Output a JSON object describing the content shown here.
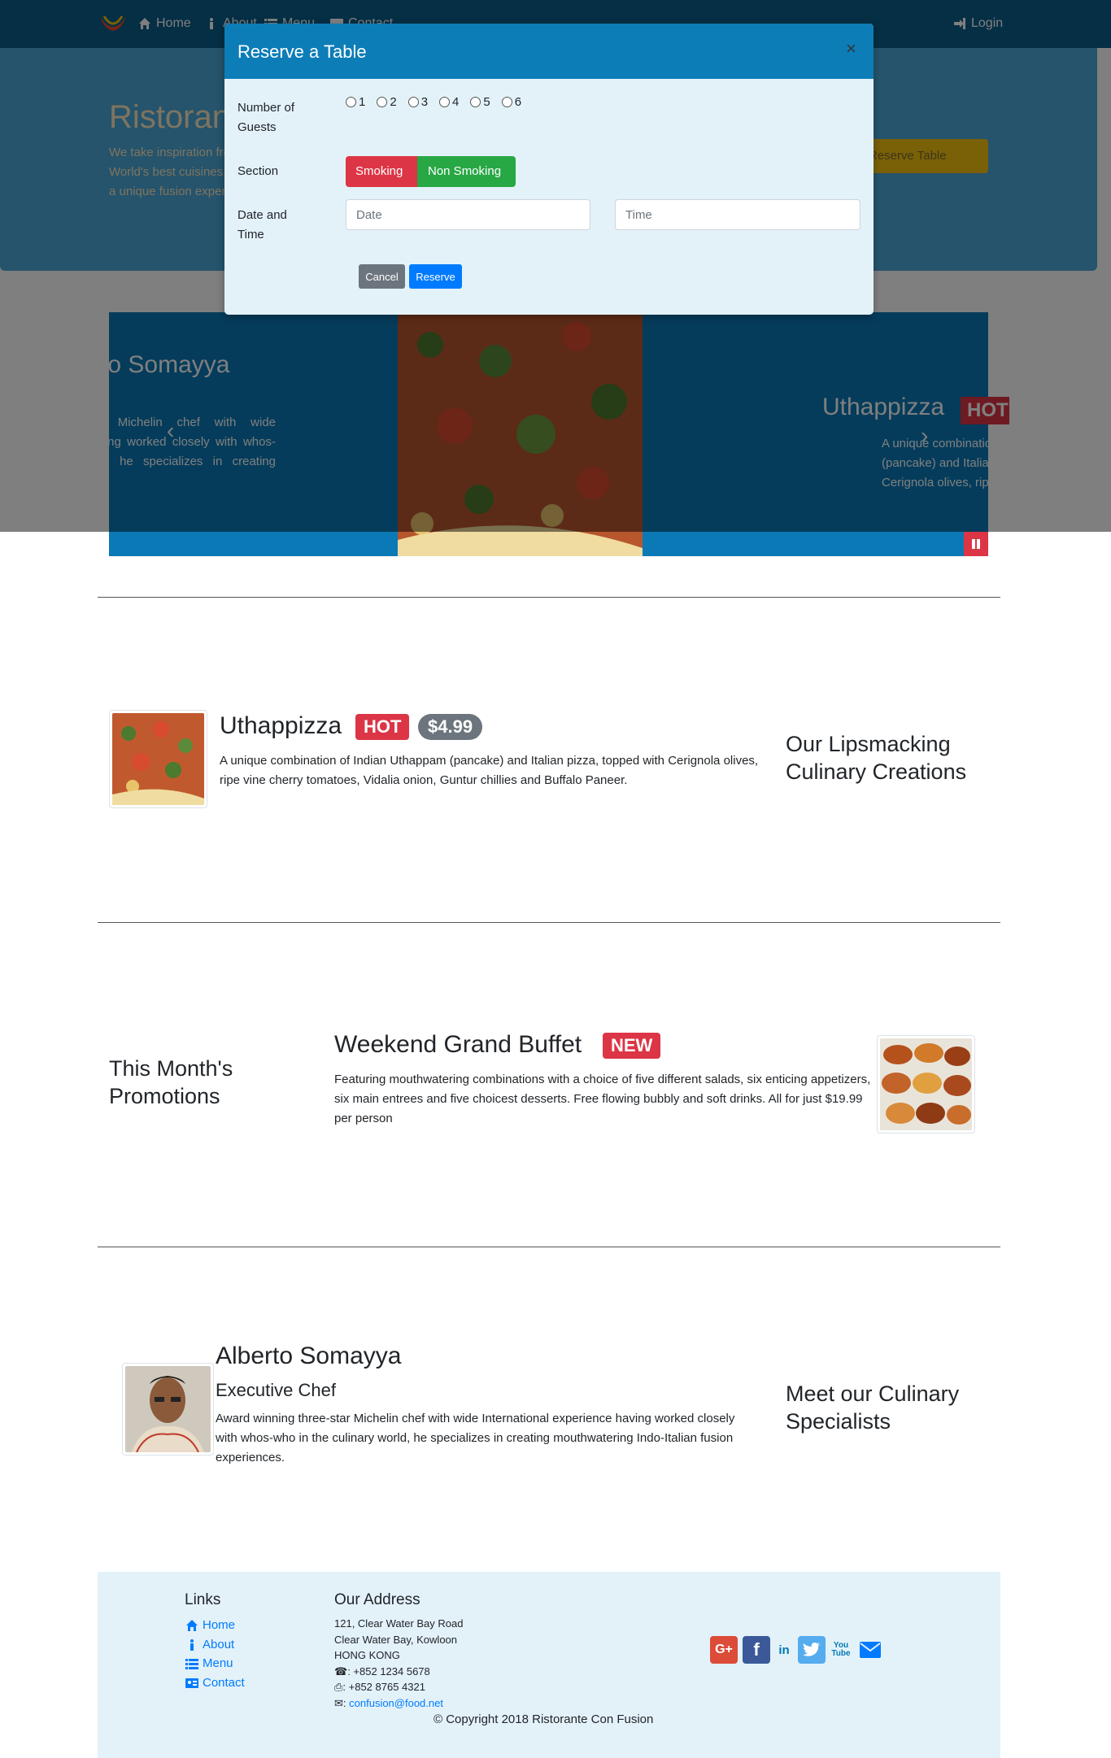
{
  "navbar": {
    "home": "Home",
    "about": "About",
    "menu": "Menu",
    "contact": "Contact",
    "login": "Login"
  },
  "jumbotron": {
    "title": "Ristorante con Fusion",
    "text": "We take inspiration from the World's best cuisines, and create a unique fusion experience. Our lipsmacking creations will tickle your culinary senses!",
    "button": "Reserve Table"
  },
  "carousel": {
    "left_title": "Alberto Somayya",
    "left_text": "Award winning three-star Michelin chef with wide International experience having worked closely with whos-who in the culinary world, he specializes in creating mouthwatering Indo-Italian fusion experiences.",
    "right_title": "Uthappizza",
    "right_badge": "HOT",
    "right_text": "A unique combination of Indian Uthappam (pancake) and Italian pizza, topped with Cerignola olives, ripe vine cherry tomatoes, Vidalia onion, Guntur chillies and Buffalo Paneer."
  },
  "modal": {
    "title": "Reserve a Table",
    "close": "×",
    "guests_label": "Number of Guests",
    "guest_options": [
      "1",
      "2",
      "3",
      "4",
      "5",
      "6"
    ],
    "section_label": "Section",
    "smoking": "Smoking",
    "non_smoking": "Non Smoking",
    "datetime_label": "Date and Time",
    "date_placeholder": "Date",
    "time_placeholder": "Time",
    "cancel": "Cancel",
    "reserve": "Reserve"
  },
  "dish": {
    "title": "Uthappizza",
    "badge": "HOT",
    "price": "$4.99",
    "text": "A unique combination of Indian Uthappam (pancake) and Italian pizza, topped with Cerignola olives, ripe vine cherry tomatoes, Vidalia onion, Guntur chillies and Buffalo Paneer.",
    "side_heading": "Our Lipsmacking Culinary Creations"
  },
  "promotion": {
    "side_heading": "This Month's Promotions",
    "title": "Weekend Grand Buffet",
    "badge": "NEW",
    "text": "Featuring mouthwatering combinations with a choice of five different salads, six enticing appetizers, six main entrees and five choicest desserts. Free flowing bubbly and soft drinks. All for just $19.99 per person"
  },
  "leader": {
    "name": "Alberto Somayya",
    "designation": "Executive Chef",
    "text": "Award winning three-star Michelin chef with wide International experience having worked closely with whos-who in the culinary world, he specializes in creating mouthwatering Indo-Italian fusion experiences.",
    "side_heading": "Meet our Culinary Specialists"
  },
  "footer": {
    "links_heading": "Links",
    "links": [
      "Home",
      "About",
      "Menu",
      "Contact"
    ],
    "address_heading": "Our Address",
    "address_lines": [
      "121, Clear Water Bay Road",
      "Clear Water Bay, Kowloon",
      "HONG KONG"
    ],
    "phone": ": +852 1234 5678",
    "fax": ": +852 8765 4321",
    "email": "confusion@food.net",
    "copyright": "© Copyright 2018 Ristorante Con Fusion"
  },
  "colors": {
    "primary": "#0d7db8",
    "navbar": "#0b5f8b",
    "danger": "#dc3545",
    "success": "#28a745",
    "link": "#007bff"
  }
}
